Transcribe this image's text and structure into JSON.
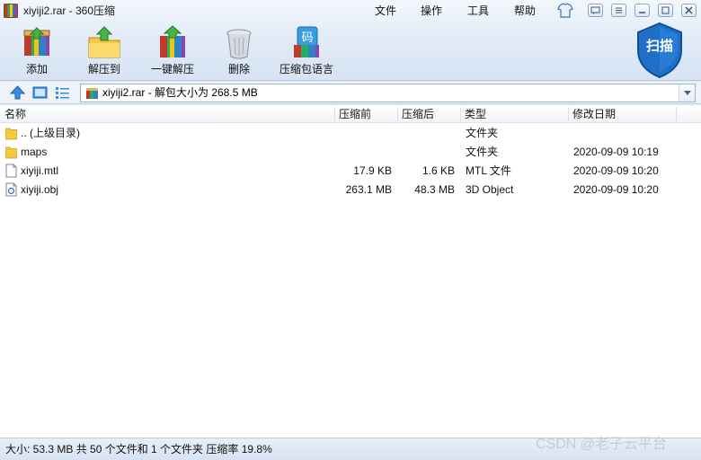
{
  "window": {
    "title": "xiyiji2.rar - 360压缩"
  },
  "menu": [
    "文件",
    "操作",
    "工具",
    "帮助"
  ],
  "toolbar": {
    "add": "添加",
    "extract_to": "解压到",
    "one_click": "一键解压",
    "delete": "删除",
    "comment": "压缩包语言",
    "scan": "扫描"
  },
  "address": {
    "text": "xiyiji2.rar - 解包大小为 268.5 MB"
  },
  "columns": {
    "name": "名称",
    "packed": "压缩前",
    "unpacked": "压缩后",
    "type": "类型",
    "modified": "修改日期"
  },
  "files": [
    {
      "name": ".. (上级目录)",
      "packed": "",
      "unpacked": "",
      "type": "文件夹",
      "modified": "",
      "icon": "folder-up-icon"
    },
    {
      "name": "maps",
      "packed": "",
      "unpacked": "",
      "type": "文件夹",
      "modified": "2020-09-09 10:19",
      "icon": "folder-icon"
    },
    {
      "name": "xiyiji.mtl",
      "packed": "17.9 KB",
      "unpacked": "1.6 KB",
      "type": "MTL 文件",
      "modified": "2020-09-09 10:20",
      "icon": "file-icon"
    },
    {
      "name": "xiyiji.obj",
      "packed": "263.1 MB",
      "unpacked": "48.3 MB",
      "type": "3D Object",
      "modified": "2020-09-09 10:20",
      "icon": "object-file-icon"
    }
  ],
  "status": {
    "text": "大小: 53.3 MB 共 50 个文件和 1 个文件夹 压缩率 19.8%"
  },
  "watermark": "CSDN @老子云平台",
  "colors": {
    "accent": "#2b6fc2",
    "folder": "#f5c842",
    "shield": "#1f6fc9"
  }
}
